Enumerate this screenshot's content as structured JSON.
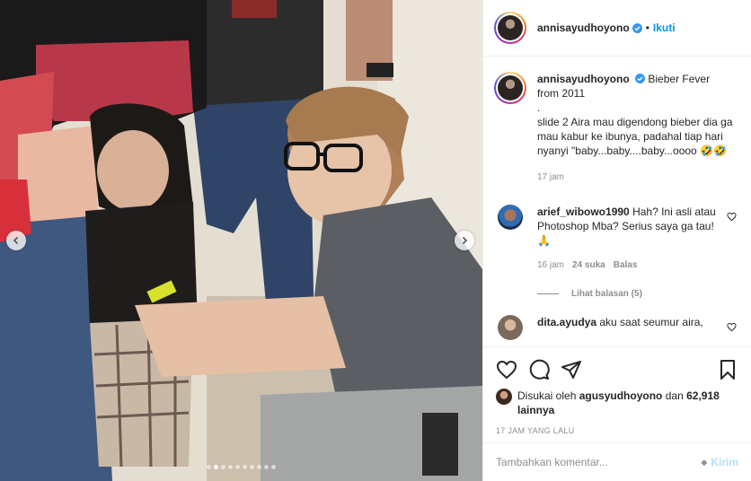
{
  "post_header": {
    "username": "annisayudhoyono",
    "separator": "•",
    "follow_label": "Ikuti"
  },
  "caption": {
    "username": "annisayudhoyono",
    "title": "Bieber Fever from 2011",
    "body": ".\nslide 2 Aira mau digendong bieber dia ga mau kabur ke ibunya, padahal tiap hari nyanyi \"baby...baby....baby...oooo 🤣🤣",
    "time": "17 jam"
  },
  "comments": [
    {
      "username": "arief_wibowo1990",
      "text": "Hah? Ini asli atau Photoshop Mba? Serius saya ga tau!🙏",
      "time": "16 jam",
      "likes": "24 suka",
      "reply_label": "Balas",
      "view_replies": "Lihat balasan (5)"
    },
    {
      "username": "dita.ayudya",
      "text": "aku saat seumur aira,"
    }
  ],
  "likes": {
    "prefix": "Disukai oleh",
    "user": "agusyudhoyono",
    "and": "dan",
    "count": "62,918 lainnya"
  },
  "timestamp": "17 JAM YANG LALU",
  "add_comment": {
    "placeholder": "Tambahkan komentar...",
    "post_label": "Kirim"
  },
  "carousel": {
    "total": 10,
    "active_index": 1
  },
  "colors": {
    "accent": "#0095f6",
    "verified": "#3897f0",
    "muted": "#8e8e8e"
  },
  "icons": [
    "verified-badge-icon",
    "chevron-left-icon",
    "chevron-right-icon",
    "heart-icon",
    "comment-icon",
    "share-icon",
    "bookmark-icon",
    "emoji-icon"
  ]
}
